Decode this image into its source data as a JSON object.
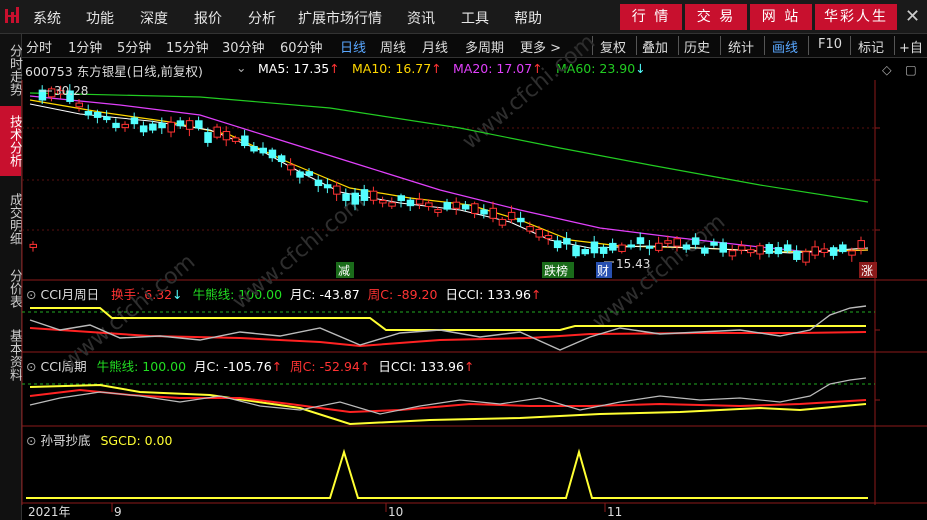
{
  "menu": {
    "items": [
      "系统",
      "功能",
      "深度",
      "报价",
      "分析",
      "扩展市场行情",
      "资讯",
      "工具",
      "帮助"
    ],
    "buttons": [
      "行 情",
      "交 易",
      "网 站",
      "华彩人生"
    ]
  },
  "toolbar": {
    "periods": [
      "分时",
      "1分钟",
      "5分钟",
      "15分钟",
      "30分钟",
      "60分钟",
      "日线",
      "周线",
      "月线",
      "多周期",
      "更多 >"
    ],
    "active_period": "日线",
    "right_tools": [
      "复权",
      "叠加",
      "历史",
      "统计",
      "画线",
      "F10",
      "标记",
      "+自"
    ],
    "active_tool": "画线"
  },
  "side_tabs": [
    "分时走势",
    "技术分析",
    "成交明细",
    "分价表",
    "基本资料"
  ],
  "active_side_tab": "技术分析",
  "main_chart": {
    "title": "600753 东方银星(日线,前复权)",
    "ma": [
      {
        "label": "MA5: 17.35",
        "arrow": "↑",
        "color": "#ffffff"
      },
      {
        "label": "MA10: 16.77",
        "arrow": "↑",
        "color": "#ffd700"
      },
      {
        "label": "MA20: 17.07",
        "arrow": "↑",
        "color": "#e040fb"
      },
      {
        "label": "MA60: 23.90",
        "arrow": "↓",
        "color": "#22cc22"
      }
    ],
    "high_label": "30.28",
    "low_label": "15.43",
    "badges": [
      "减",
      "跌榜",
      "财",
      "涨"
    ],
    "watermark": "www.cfchi.com"
  },
  "panel1": {
    "name": "CCI月周日",
    "fields": [
      {
        "label": "换手: 6.32",
        "arrow": "↓",
        "color": "#ff3333"
      },
      {
        "label": "牛熊线: 100.00",
        "arrow": "",
        "color": "#22dd22"
      },
      {
        "label": "月C: -43.87",
        "arrow": "",
        "color": "#ffffff"
      },
      {
        "label": "周C: -89.20",
        "arrow": "",
        "color": "#ff3333"
      },
      {
        "label": "日CCI: 133.96",
        "arrow": "↑",
        "color": "#ffffff"
      }
    ]
  },
  "panel2": {
    "name": "CCI周期",
    "fields": [
      {
        "label": "牛熊线: 100.00",
        "arrow": "",
        "color": "#22dd22"
      },
      {
        "label": "月C: -105.76",
        "arrow": "↑",
        "color": "#ffffff"
      },
      {
        "label": "周C: -52.94",
        "arrow": "↑",
        "color": "#ff3333"
      },
      {
        "label": "日CCI: 133.96",
        "arrow": "↑",
        "color": "#ffffff"
      }
    ]
  },
  "panel3": {
    "name": "孙哥抄底",
    "field": "SGCD: 0.00"
  },
  "x_axis": {
    "labels": [
      "2021年",
      "9",
      "10",
      "11"
    ]
  },
  "colors": {
    "up": "#ff3333",
    "down": "#54ffff",
    "ma5": "#ffffff",
    "ma10": "#ffd700",
    "ma20": "#e040fb",
    "ma60": "#22cc22",
    "accent": "#c8102e"
  }
}
